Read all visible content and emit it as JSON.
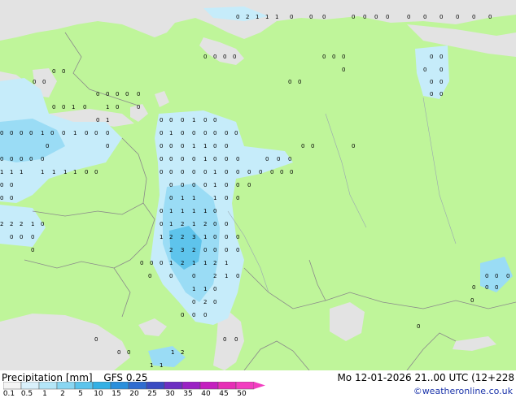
{
  "title": {
    "product": "Precipitation [mm]",
    "model": "GFS 0.25",
    "valid_time": "Mo 12-01-2026 21..00 UTC (12+228"
  },
  "credit": "©weatheronline.co.uk",
  "colorbar": {
    "ticks": [
      "0.1",
      "0.5",
      "1",
      "2",
      "5",
      "10",
      "15",
      "20",
      "25",
      "30",
      "35",
      "40",
      "45",
      "50"
    ],
    "colors": [
      "#f4f4f4",
      "#d9f0fb",
      "#b4e6f8",
      "#8ad6f2",
      "#5cc4ec",
      "#34b0e4",
      "#2a8fdb",
      "#2f6cd0",
      "#3a4bc2",
      "#6d2fc2",
      "#9a22c4",
      "#c41fbf",
      "#e62fb6",
      "#f23ec0"
    ]
  },
  "colors": {
    "land": "#bff59a",
    "sea": "#e3e3e3",
    "precip_light": "#c6ecfa",
    "precip_mid": "#9adcf5",
    "precip_heavy": "#5ec4ec",
    "border": "#8a8a8a"
  }
}
